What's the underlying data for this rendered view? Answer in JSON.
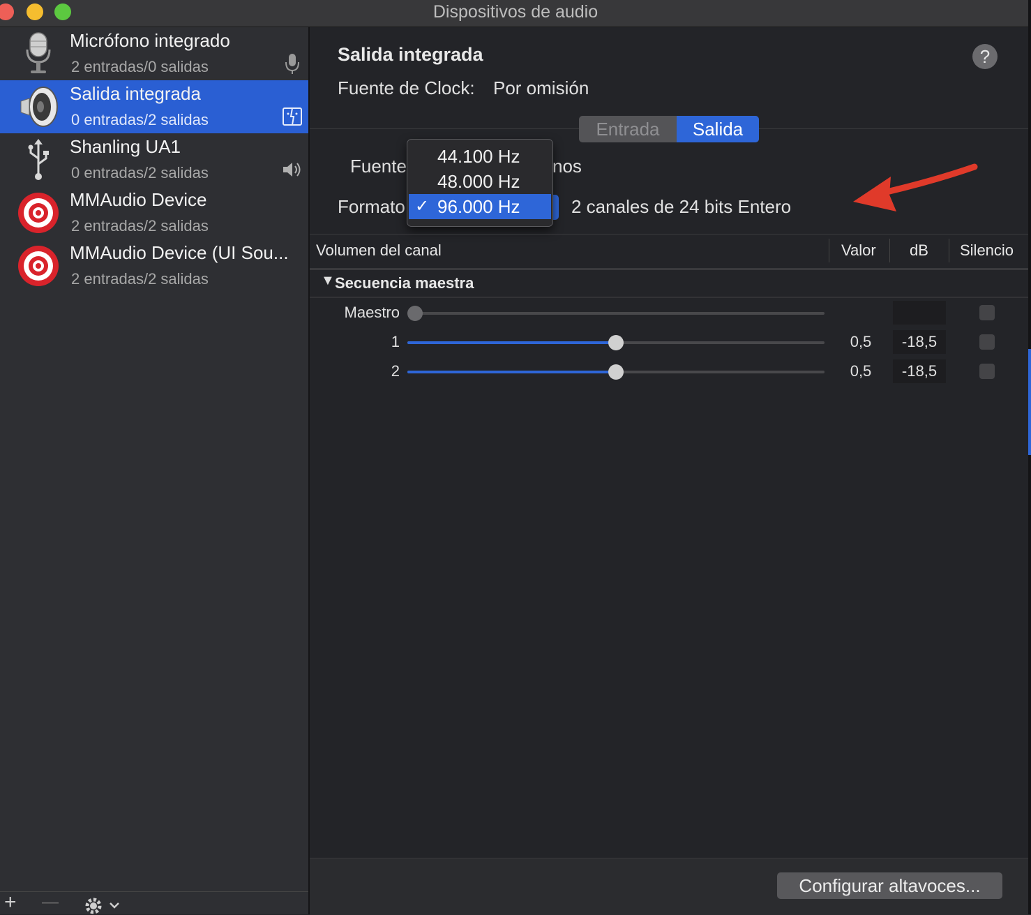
{
  "window": {
    "title": "Dispositivos de audio"
  },
  "devices": [
    {
      "name": "Micrófono integrado",
      "io": "2 entradas/0 salidas",
      "icon": "microphone-icon",
      "badge": "mic-badge-icon",
      "selected": false
    },
    {
      "name": "Salida integrada",
      "io": "0 entradas/2 salidas",
      "icon": "speaker-icon",
      "badge": "finder-badge-icon",
      "selected": true
    },
    {
      "name": "Shanling UA1",
      "io": "0 entradas/2 salidas",
      "icon": "usb-icon",
      "badge": "volume-badge-icon",
      "selected": false
    },
    {
      "name": "MMAudio Device",
      "io": "2 entradas/2 salidas",
      "icon": "target-icon",
      "selected": false
    },
    {
      "name": "MMAudio Device (UI Sou...",
      "io": "2 entradas/2 salidas",
      "icon": "target-icon",
      "selected": false
    }
  ],
  "sidebar_footer": {
    "add": "+",
    "remove": "—"
  },
  "detail": {
    "title": "Salida integrada",
    "help": "?",
    "clock_label": "Fuente de Clock:",
    "clock_value": "Por omisión",
    "tabs": {
      "input": "Entrada",
      "output": "Salida",
      "active": "output"
    },
    "source_label": "Fuente",
    "source_value_tail": "nos",
    "format_label": "Formato",
    "format_desc": "2 canales de 24 bits Entero",
    "sample_rates": [
      {
        "label": "44.100 Hz",
        "checked": false
      },
      {
        "label": "48.000 Hz",
        "checked": false
      },
      {
        "label": "96.000 Hz",
        "checked": true
      }
    ],
    "check_mark": "✓",
    "annotation_color": "#e03a2a"
  },
  "table": {
    "headers": {
      "channel": "Volumen del canal",
      "value": "Valor",
      "db": "dB",
      "mute": "Silencio"
    },
    "group": {
      "label": "Secuencia maestra",
      "expanded": true
    },
    "rows": [
      {
        "label": "Maestro",
        "value": "",
        "db": "",
        "level": 0.0,
        "enabled": false,
        "mute": false
      },
      {
        "label": "1",
        "value": "0,5",
        "db": "-18,5",
        "level": 0.5,
        "enabled": true,
        "mute": false
      },
      {
        "label": "2",
        "value": "0,5",
        "db": "-18,5",
        "level": 0.5,
        "enabled": true,
        "mute": false
      }
    ]
  },
  "footer": {
    "configure_button": "Configurar altavoces..."
  },
  "colors": {
    "accent": "#2e66d8",
    "background": "#232428",
    "sidebar": "#2e2f33"
  }
}
